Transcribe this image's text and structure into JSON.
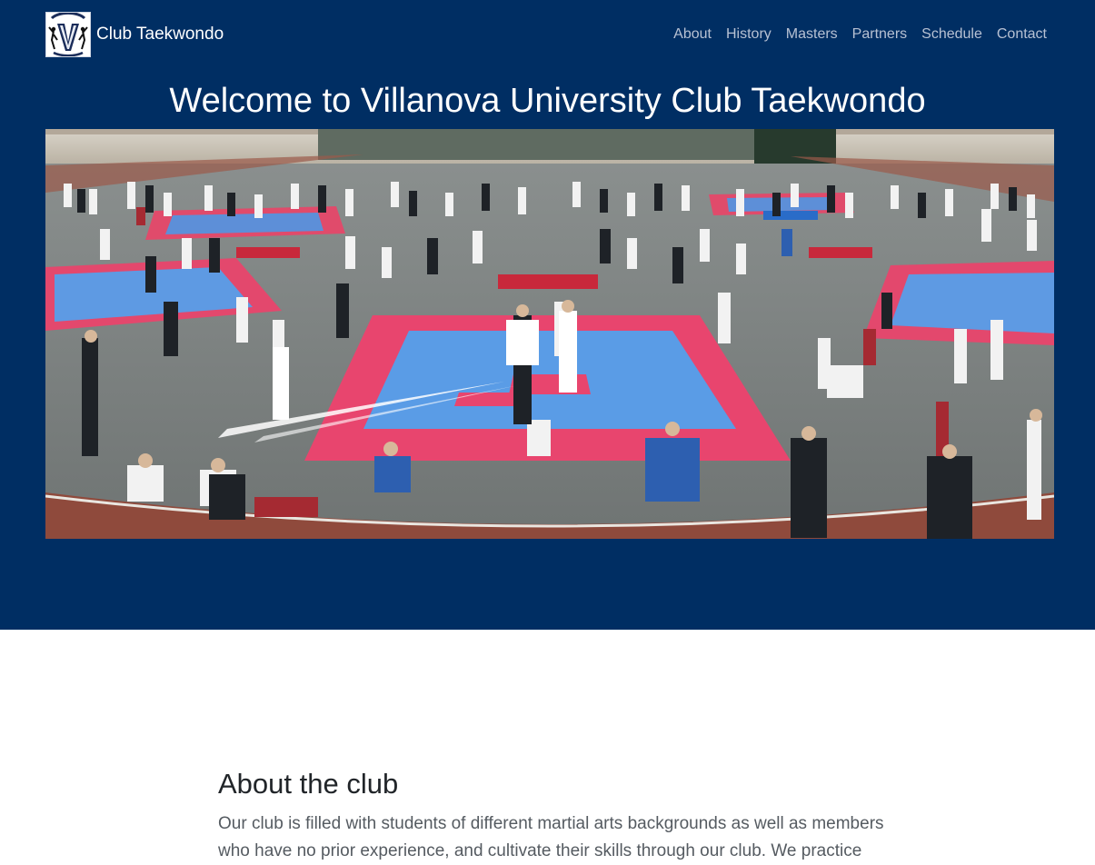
{
  "navbar": {
    "logo_icon": "villanova-taekwondo-logo",
    "brand": "Club Taekwondo",
    "links": [
      "About",
      "History",
      "Masters",
      "Partners",
      "Schedule",
      "Contact"
    ]
  },
  "hero": {
    "title": "Welcome to Villanova University Club Taekwondo",
    "background_color": "#002e63",
    "image_description_icon": "tournament-photo"
  },
  "about": {
    "heading": "About the club",
    "text": "Our club is filled with students of different martial arts backgrounds as well as members who have no prior experience, and cultivate their skills through our club. We practice"
  },
  "colors": {
    "navy": "#002e63",
    "nav_link": "#b7c1d3",
    "heading_text": "#212529",
    "body_text": "#555b61"
  }
}
